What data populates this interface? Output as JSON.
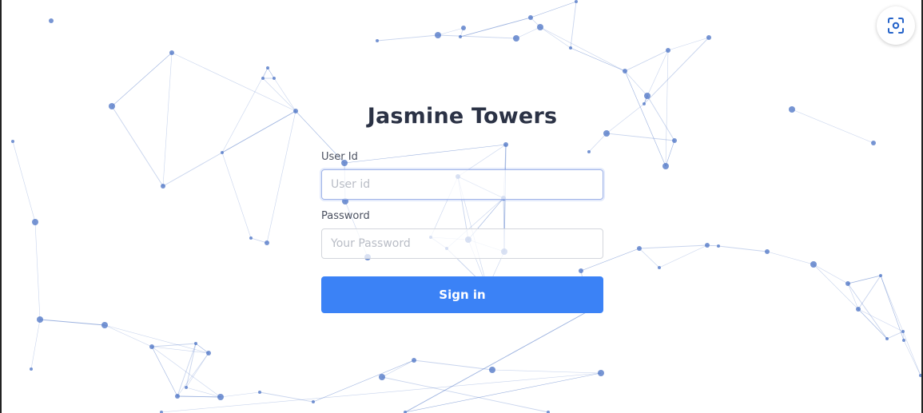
{
  "app": {
    "title": "Jasmine Towers"
  },
  "login": {
    "user_label": "User Id",
    "user_placeholder": "User id",
    "user_value": "",
    "password_label": "Password",
    "password_placeholder": "Your Password",
    "password_value": "",
    "submit_label": "Sign in"
  },
  "toolbar": {
    "scan_icon": "screen-capture-icon"
  },
  "colors": {
    "accent": "#3b82f6",
    "title": "#2b3245",
    "network": "#4a72c4"
  }
}
